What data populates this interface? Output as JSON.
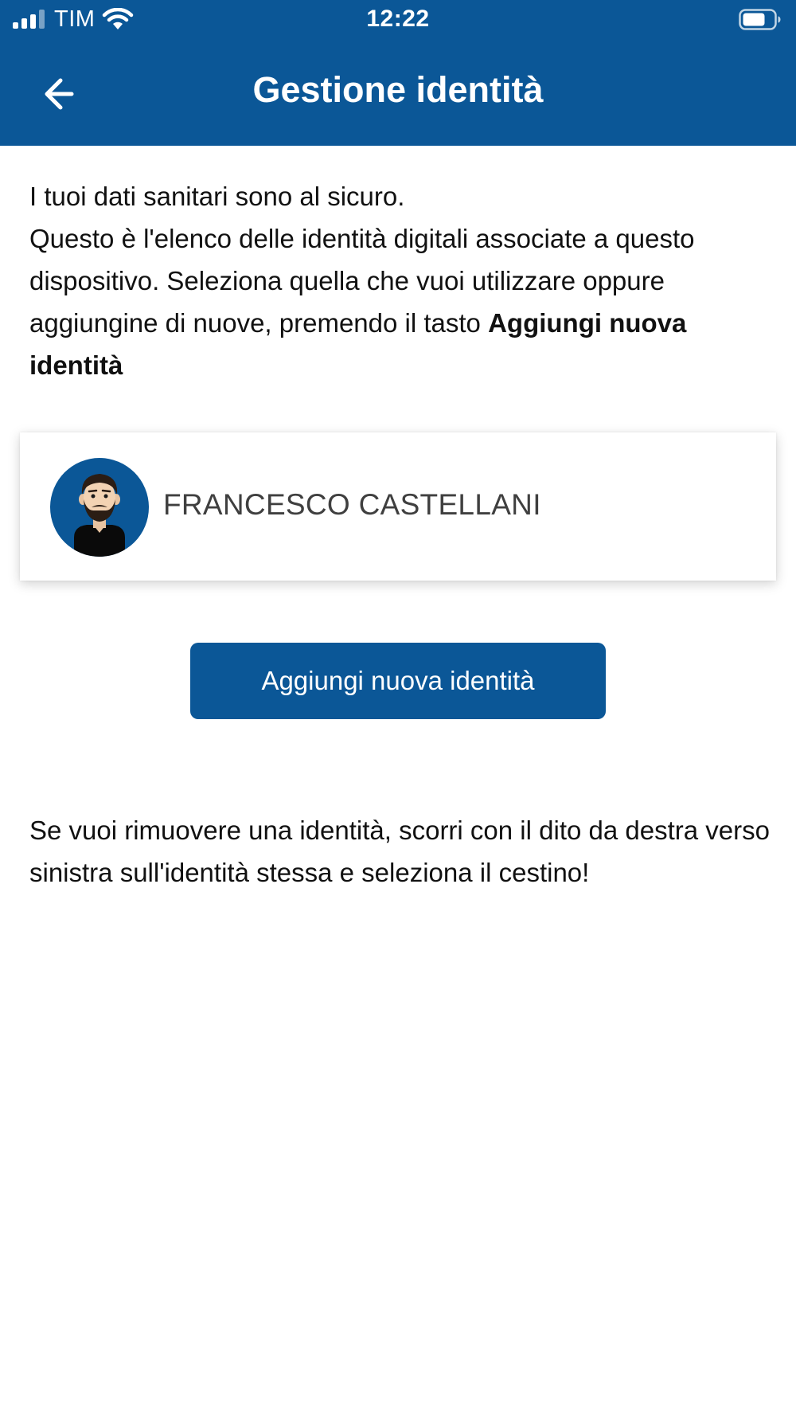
{
  "status_bar": {
    "carrier": "TIM",
    "time": "12:22"
  },
  "header": {
    "title": "Gestione identità",
    "back_icon": "arrow-left-icon"
  },
  "intro": {
    "line1": "I tuoi dati sanitari sono al sicuro.",
    "line2": "Questo è l'elenco delle identità digitali associate a questo dispositivo. Seleziona quella che vuoi utilizzare oppure aggiungine di nuove, premendo il tasto ",
    "highlight": "Aggiungi nuova identità"
  },
  "identities": [
    {
      "name": "FRANCESCO CASTELLANI",
      "avatar_icon": "man-avatar-icon"
    }
  ],
  "add_button_label": "Aggiungi nuova identità",
  "remove_hint": "Se vuoi rimuovere una identità, scorri con il dito da destra verso sinistra sull'identità stessa e seleziona il cestino!",
  "colors": {
    "primary": "#0b5797",
    "background": "#ffffff",
    "text": "#111111"
  }
}
